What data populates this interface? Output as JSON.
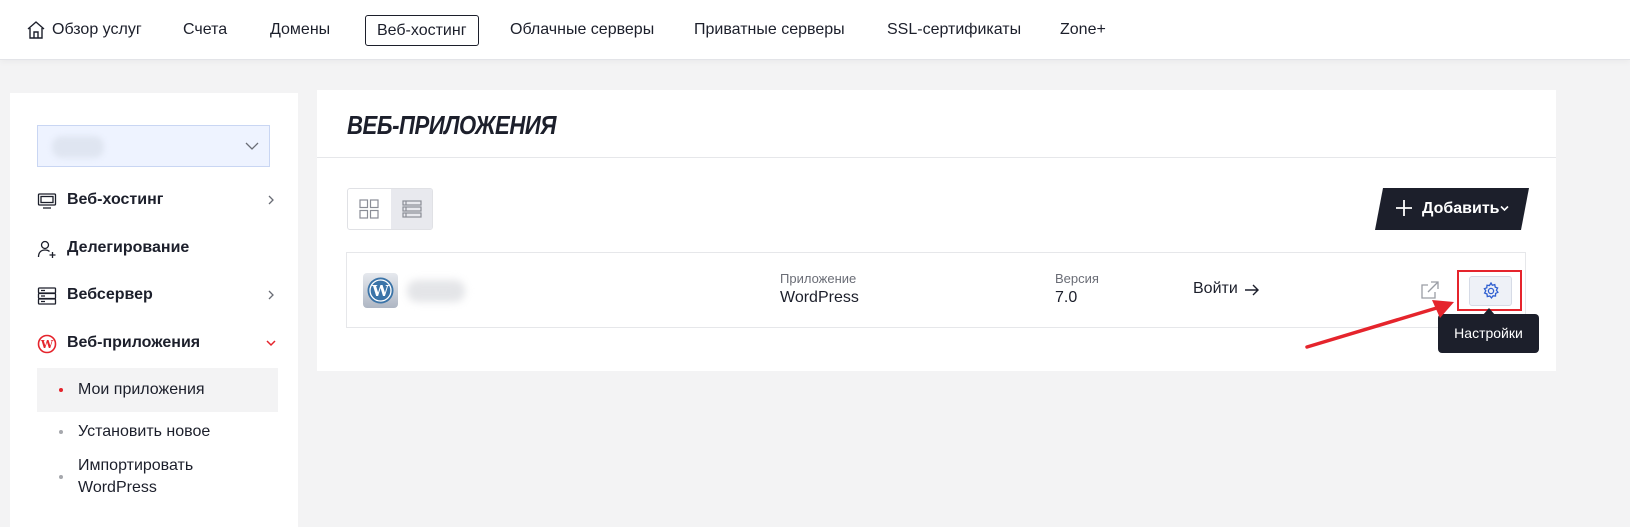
{
  "topnav": {
    "items": [
      {
        "label": "Обзор услуг"
      },
      {
        "label": "Счета"
      },
      {
        "label": "Домены"
      },
      {
        "label": "Веб-хостинг",
        "active": true
      },
      {
        "label": "Облачные серверы"
      },
      {
        "label": "Приватные серверы"
      },
      {
        "label": "SSL-сертификаты"
      },
      {
        "label": "Zone+"
      }
    ]
  },
  "sidebar": {
    "items": [
      {
        "label": "Веб-хостинг",
        "icon": "monitor-icon"
      },
      {
        "label": "Делегирование",
        "icon": "user-plus-icon"
      },
      {
        "label": "Вебсервер",
        "icon": "server-icon"
      },
      {
        "label": "Веб-приложения",
        "icon": "wordpress-icon",
        "expanded": true
      }
    ],
    "subitems": [
      {
        "label": "Мои приложения",
        "active": true
      },
      {
        "label": "Установить новое"
      },
      {
        "label": "Импортировать",
        "label2": "WordPress"
      }
    ]
  },
  "main": {
    "title": "ВЕБ-ПРИЛОЖЕНИЯ",
    "add_button": "Добавить",
    "row": {
      "app_label": "Приложение",
      "app_value": "WordPress",
      "version_label": "Версия",
      "version_value": "7.0",
      "login_label": "Войти"
    },
    "tooltip": "Настройки"
  },
  "colors": {
    "accent_red": "#e5242c",
    "dark": "#1c1f2b",
    "gear_blue": "#2f5fd0"
  }
}
